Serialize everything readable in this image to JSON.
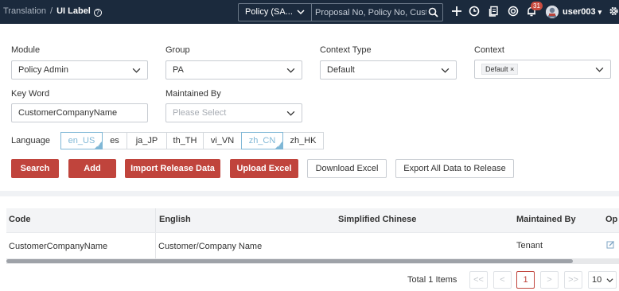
{
  "topbar": {
    "breadcrumb_parent": "Translation",
    "breadcrumb_sep": "/",
    "breadcrumb_current": "UI Label",
    "help_glyph": "?",
    "policy_select": "Policy (SA...",
    "search_placeholder": "Proposal No, Policy No, Cust",
    "notification_count": "31",
    "username": "user003"
  },
  "filters": {
    "module": {
      "label": "Module",
      "value": "Policy Admin"
    },
    "group": {
      "label": "Group",
      "value": "PA"
    },
    "context_type": {
      "label": "Context Type",
      "value": "Default"
    },
    "context": {
      "label": "Context",
      "tag": "Default",
      "tag_remove": "×"
    },
    "keyword": {
      "label": "Key Word",
      "value": "CustomerCompanyName"
    },
    "maintained_by": {
      "label": "Maintained By",
      "placeholder": "Please Select"
    },
    "language": {
      "label": "Language",
      "options": [
        "en_US",
        "es",
        "ja_JP",
        "th_TH",
        "vi_VN",
        "zh_CN",
        "zh_HK"
      ],
      "selected": [
        "en_US",
        "zh_CN"
      ]
    }
  },
  "buttons": {
    "search": "Search",
    "add": "Add",
    "import": "Import Release Data",
    "upload": "Upload Excel",
    "download": "Download Excel",
    "export": "Export All Data to Release"
  },
  "table": {
    "columns": [
      "Code",
      "English",
      "Simplified Chinese",
      "Maintained By",
      "Op"
    ],
    "rows": [
      {
        "code": "CustomerCompanyName",
        "english": "Customer/Company Name",
        "simplified_chinese": "",
        "maintained_by": "Tenant"
      }
    ]
  },
  "pagination": {
    "total": "Total 1 Items",
    "first": "<<",
    "prev": "<",
    "current": "1",
    "next": ">",
    "last": ">>",
    "page_size": "10"
  },
  "colors": {
    "topbar_bg": "#1b2a3d",
    "primary_red": "#c0443c",
    "selected_blue": "#7fb7d6"
  }
}
